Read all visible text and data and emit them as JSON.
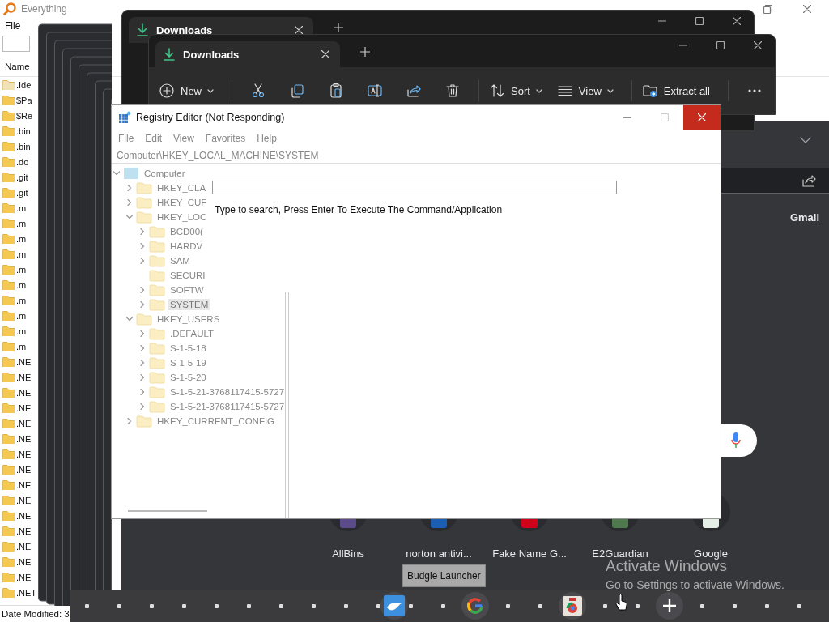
{
  "everything": {
    "title": "Everything",
    "menu": [
      "File"
    ],
    "column": "Name",
    "files": [
      ".Ide",
      "$Pa",
      "$Re",
      ".bin",
      ".bin",
      ".do",
      ".git",
      ".git",
      ".m",
      ".m",
      ".m",
      ".m",
      ".m",
      ".m",
      ".m",
      ".m",
      ".m",
      ".m",
      ".NE",
      ".NE",
      ".NE",
      ".NE",
      ".NE",
      ".NE",
      ".NE",
      ".NE",
      ".NE",
      ".NE",
      ".NE",
      ".NE",
      ".NE",
      ".NE",
      ".NE",
      ".NET"
    ],
    "status": "Date Modified: 3"
  },
  "explorer_back": {
    "tab": "Downloads"
  },
  "explorer_front": {
    "tab": "Downloads",
    "toolbar": {
      "new": "New",
      "sort": "Sort",
      "view": "View",
      "extract": "Extract all"
    }
  },
  "browser": {
    "gmail": "Gmail",
    "tooltip": "Budgie Launcher",
    "shortcuts": [
      {
        "label": "AllBins",
        "color": "#5b4b8a"
      },
      {
        "label": "norton antivi...",
        "color": "#1a5fb4"
      },
      {
        "label": "Fake Name G...",
        "color": "#d0021b"
      },
      {
        "label": "E2Guardian",
        "color": "#4e7a4e"
      },
      {
        "label": "Google",
        "color": "#e6efe6"
      }
    ]
  },
  "registry": {
    "title": "Registry Editor (Not Responding)",
    "menu": [
      "File",
      "Edit",
      "View",
      "Favorites",
      "Help"
    ],
    "address": "Computer\\HKEY_LOCAL_MACHINE\\SYSTEM",
    "tree": [
      {
        "label": "Computer",
        "kind": "computer",
        "expandable": true,
        "expanded": true,
        "selected": false,
        "children": [
          {
            "label": "HKEY_CLA",
            "kind": "folder",
            "expandable": true,
            "expanded": false,
            "selected": false
          },
          {
            "label": "HKEY_CUF",
            "kind": "folder",
            "expandable": true,
            "expanded": false,
            "selected": false
          },
          {
            "label": "HKEY_LOC",
            "kind": "folder",
            "expandable": true,
            "expanded": true,
            "selected": false,
            "children": [
              {
                "label": "BCD00(",
                "kind": "folder",
                "expandable": true,
                "expanded": false,
                "selected": false
              },
              {
                "label": "HARDV",
                "kind": "folder",
                "expandable": true,
                "expanded": false,
                "selected": false
              },
              {
                "label": "SAM",
                "kind": "folder",
                "expandable": true,
                "expanded": false,
                "selected": false
              },
              {
                "label": "SECURI",
                "kind": "folder",
                "expandable": false,
                "expanded": false,
                "selected": false
              },
              {
                "label": "SOFTW",
                "kind": "folder",
                "expandable": true,
                "expanded": false,
                "selected": false
              },
              {
                "label": "SYSTEM",
                "kind": "folder",
                "expandable": true,
                "expanded": false,
                "selected": true
              }
            ]
          },
          {
            "label": "HKEY_USERS",
            "kind": "folder",
            "expandable": true,
            "expanded": true,
            "selected": false,
            "children": [
              {
                "label": ".DEFAULT",
                "kind": "folder",
                "expandable": true,
                "expanded": false,
                "selected": false
              },
              {
                "label": "S-1-5-18",
                "kind": "folder",
                "expandable": true,
                "expanded": false,
                "selected": false
              },
              {
                "label": "S-1-5-19",
                "kind": "folder",
                "expandable": true,
                "expanded": false,
                "selected": false
              },
              {
                "label": "S-1-5-20",
                "kind": "folder",
                "expandable": true,
                "expanded": false,
                "selected": false
              },
              {
                "label": "S-1-5-21-3768117415-5727",
                "kind": "folder",
                "expandable": true,
                "expanded": false,
                "selected": false
              },
              {
                "label": "S-1-5-21-3768117415-5727",
                "kind": "folder",
                "expandable": true,
                "expanded": false,
                "selected": false
              }
            ]
          },
          {
            "label": "HKEY_CURRENT_CONFIG",
            "kind": "folder",
            "expandable": true,
            "expanded": false,
            "selected": false
          }
        ]
      }
    ],
    "hint": "Type to search, Press Enter To Execute The Command/Application"
  },
  "activation": {
    "title": "Activate Windows",
    "message": "Go to Settings to activate Windows."
  }
}
